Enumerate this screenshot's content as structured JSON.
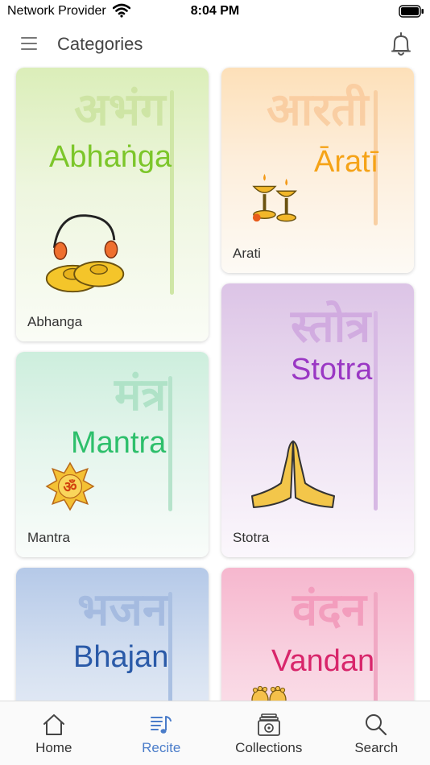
{
  "status_bar": {
    "carrier": "Network Provider",
    "time": "8:04 PM"
  },
  "header": {
    "title": "Categories"
  },
  "categories": [
    {
      "label": "Abhanga",
      "script": "अभंग",
      "roman": "Abhaṅga",
      "color": "#7cc62a"
    },
    {
      "label": "Arati",
      "script": "आरती",
      "roman": "Āratī",
      "color": "#f5a318"
    },
    {
      "label": "Stotra",
      "script": "स्तोत्र",
      "roman": "Stotra",
      "color": "#9a38c4"
    },
    {
      "label": "Mantra",
      "script": "मंत्र",
      "roman": "Mantra",
      "color": "#2dbf6b"
    },
    {
      "label": "",
      "script": "भजन",
      "roman": "Bhajan",
      "color": "#2a5aa8"
    },
    {
      "label": "",
      "script": "वंदन",
      "roman": "Vandan",
      "color": "#d8266b"
    }
  ],
  "nav": {
    "items": [
      {
        "label": "Home",
        "icon": "home-icon"
      },
      {
        "label": "Recite",
        "icon": "recite-icon"
      },
      {
        "label": "Collections",
        "icon": "collections-icon"
      },
      {
        "label": "Search",
        "icon": "search-icon"
      }
    ],
    "active": "Recite",
    "active_color": "#4a7cc9"
  }
}
